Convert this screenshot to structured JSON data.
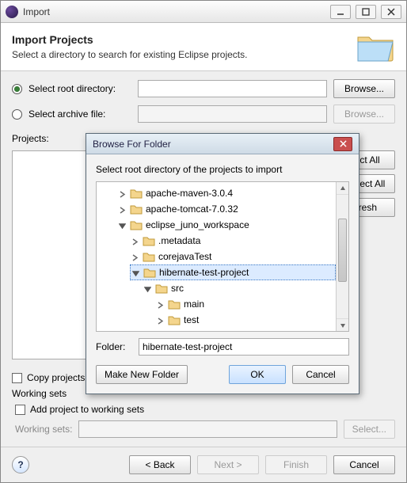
{
  "window": {
    "title": "Import"
  },
  "banner": {
    "heading": "Import Projects",
    "sub": "Select a directory to search for existing Eclipse projects."
  },
  "radios": {
    "root_label": "Select root directory:",
    "archive_label": "Select archive file:",
    "root_browse": "Browse...",
    "archive_browse": "Browse..."
  },
  "projects": {
    "label": "Projects:",
    "select_all": "Select All",
    "deselect_all": "Deselect All",
    "refresh": "Refresh"
  },
  "options": {
    "copy_label": "Copy projects into workspace",
    "working_sets_heading": "Working sets",
    "add_ws_label": "Add project to working sets",
    "ws_label": "Working sets:",
    "ws_select_btn": "Select..."
  },
  "wizard": {
    "back": "< Back",
    "next": "Next >",
    "finish": "Finish",
    "cancel": "Cancel",
    "help": "?"
  },
  "dialog": {
    "title": "Browse For Folder",
    "instruction": "Select root directory of the projects to import",
    "folder_label": "Folder:",
    "folder_value": "hibernate-test-project",
    "make_new": "Make New Folder",
    "ok": "OK",
    "cancel": "Cancel",
    "tree": {
      "n0": "apache-maven-3.0.4",
      "n1": "apache-tomcat-7.0.32",
      "n2": "eclipse_juno_workspace",
      "n3": ".metadata",
      "n4": "corejavaTest",
      "n5": "hibernate-test-project",
      "n6": "src",
      "n7": "main",
      "n8": "test"
    }
  }
}
